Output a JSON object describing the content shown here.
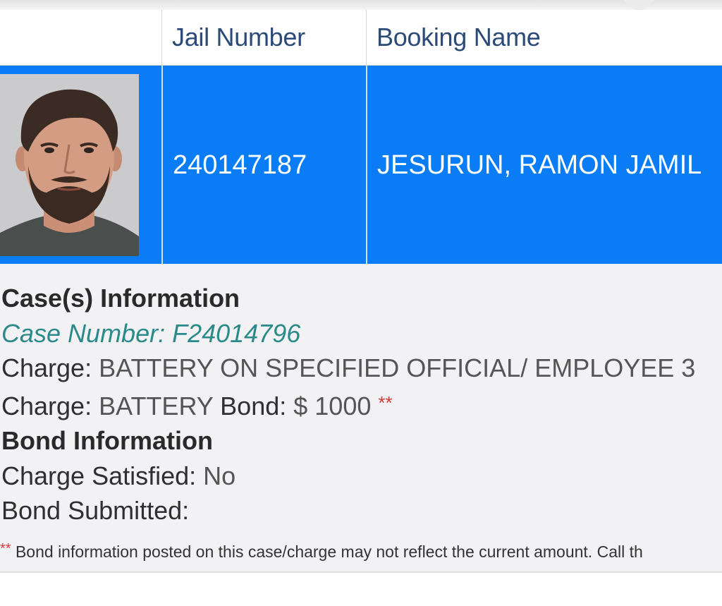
{
  "table": {
    "headers": {
      "photo": "",
      "jail_number": "Jail Number",
      "booking_name": "Booking Name"
    },
    "row": {
      "jail_number": "240147187",
      "booking_name": "JESURUN, RAMON JAMIL"
    }
  },
  "case_info": {
    "heading": "Case(s) Information",
    "case_number_label": "Case Number:",
    "case_number": "F24014796",
    "charges": [
      {
        "label": "Charge:",
        "value": "BATTERY ON SPECIFIED OFFICIAL/ EMPLOYEE 3"
      },
      {
        "label": "Charge:",
        "value": "BATTERY",
        "bond_label": "Bond:",
        "bond_value": "$ 1000",
        "marker": "**"
      }
    ]
  },
  "bond_info": {
    "heading": "Bond Information",
    "charge_satisfied_label": "Charge Satisfied:",
    "charge_satisfied_value": "No",
    "bond_submitted_label": "Bond Submitted:",
    "bond_submitted_value": ""
  },
  "footnote": {
    "marker": "**",
    "text": "Bond information posted on this case/charge may not reflect the current amount. Call th"
  },
  "colors": {
    "row_highlight": "#0a7cf5",
    "header_text": "#2b4a78",
    "case_number": "#2a8a8a",
    "required_marker": "#d23a3a"
  }
}
